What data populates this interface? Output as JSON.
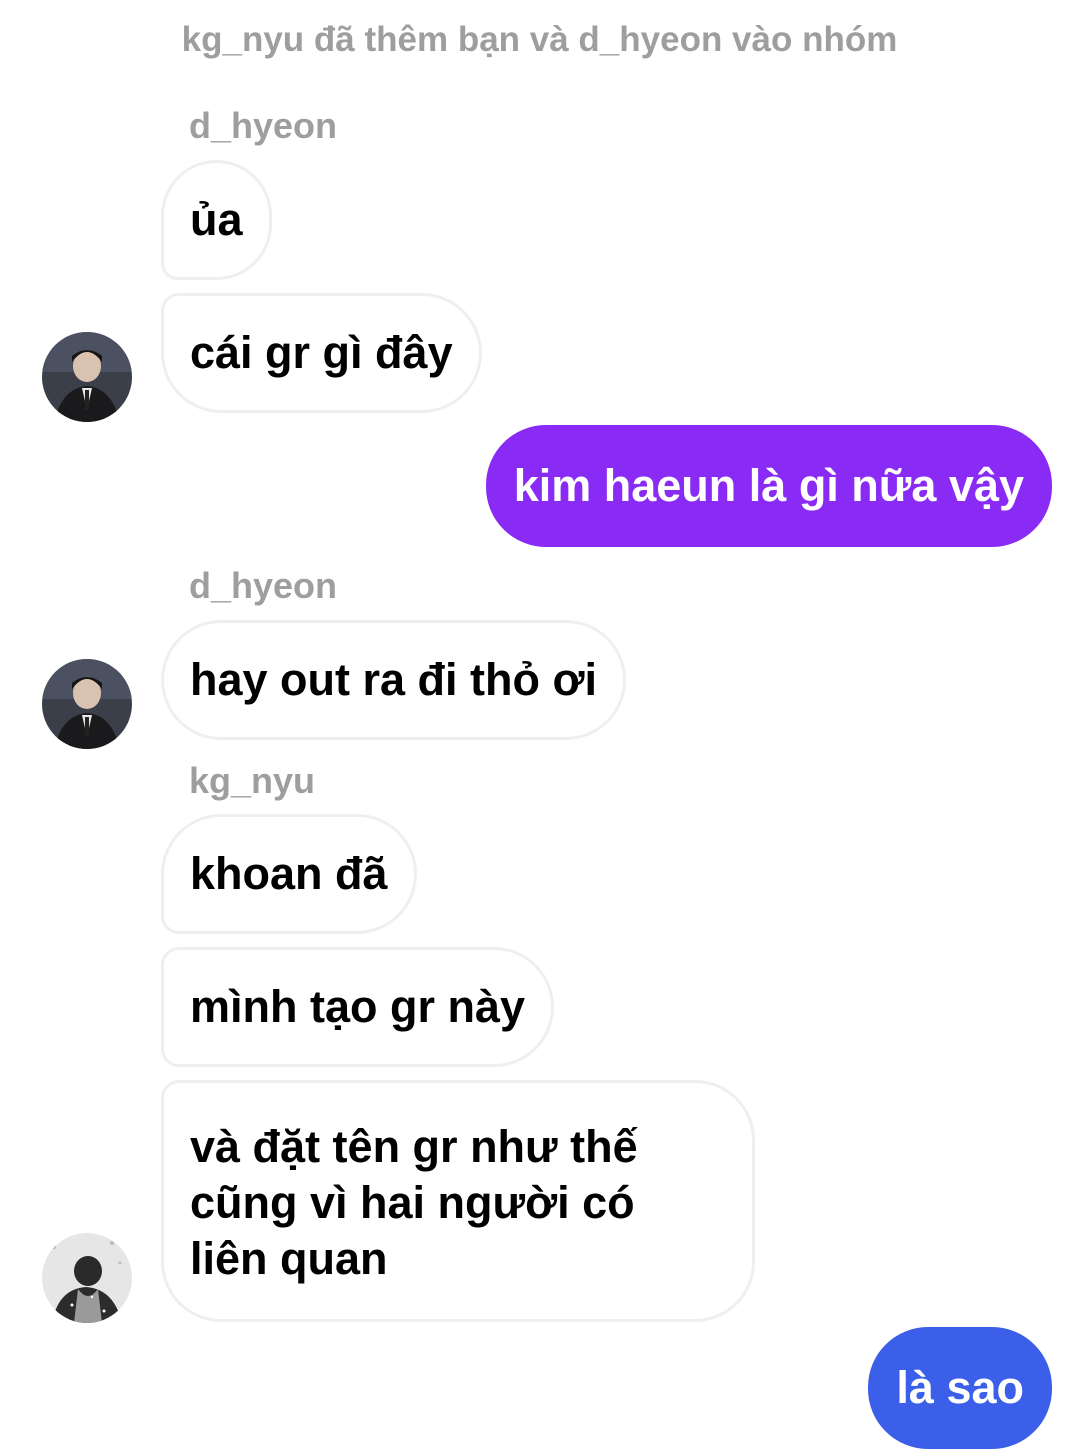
{
  "system_message": "kg_nyu đã thêm bạn và d_hyeon vào nhóm",
  "groups": [
    {
      "sender": "d_hyeon",
      "messages": [
        "ủa",
        "cái gr gì đây"
      ]
    },
    {
      "sender": "d_hyeon",
      "messages": [
        "hay out ra đi thỏ ơi"
      ]
    },
    {
      "sender": "kg_nyu",
      "messages": [
        "khoan đã",
        "mình tạo gr này",
        "và đặt tên gr như thế cũng vì hai người có liên quan"
      ]
    }
  ],
  "outgoing": [
    {
      "text": "kim haeun là gì nữa vậy",
      "color": "#8a2af5"
    },
    {
      "text": "là sao",
      "color": "#3b5fe8"
    }
  ],
  "avatars": {
    "d_hyeon": "avatar-d-hyeon",
    "kg_nyu": "avatar-kg-nyu"
  }
}
